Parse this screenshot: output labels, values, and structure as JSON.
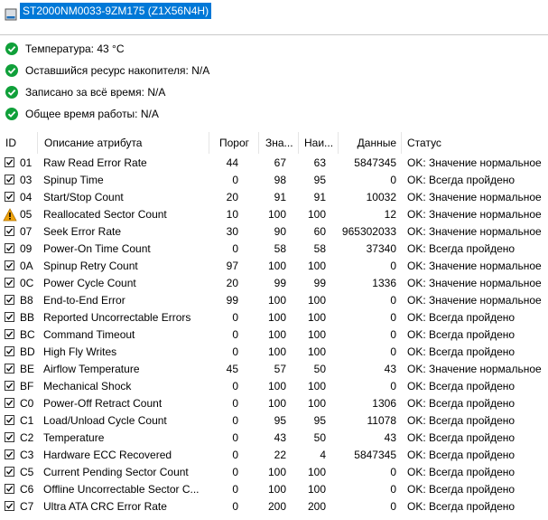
{
  "drive": {
    "title": "ST2000NM0033-9ZM175 (Z1X56N4H)"
  },
  "status": [
    {
      "label": "Температура: 43 °C"
    },
    {
      "label": "Оставшийся ресурс накопителя: N/A"
    },
    {
      "label": "Записано за всё время: N/A"
    },
    {
      "label": "Общее время работы: N/A"
    }
  ],
  "table": {
    "headers": {
      "id": "ID",
      "desc": "Описание атрибута",
      "threshold": "Порог",
      "value": "Зна...",
      "worst": "Наи...",
      "data": "Данные",
      "status": "Статус"
    },
    "rows": [
      {
        "id": "01",
        "desc": "Raw Read Error Rate",
        "threshold": "44",
        "value": "67",
        "worst": "63",
        "data": "5847345",
        "status": "OK: Значение нормальное",
        "icon": "checkbox"
      },
      {
        "id": "03",
        "desc": "Spinup Time",
        "threshold": "0",
        "value": "98",
        "worst": "95",
        "data": "0",
        "status": "OK: Всегда пройдено",
        "icon": "checkbox"
      },
      {
        "id": "04",
        "desc": "Start/Stop Count",
        "threshold": "20",
        "value": "91",
        "worst": "91",
        "data": "10032",
        "status": "OK: Значение нормальное",
        "icon": "checkbox"
      },
      {
        "id": "05",
        "desc": "Reallocated Sector Count",
        "threshold": "10",
        "value": "100",
        "worst": "100",
        "data": "12",
        "status": "OK: Значение нормальное",
        "icon": "warning"
      },
      {
        "id": "07",
        "desc": "Seek Error Rate",
        "threshold": "30",
        "value": "90",
        "worst": "60",
        "data": "965302033",
        "status": "OK: Значение нормальное",
        "icon": "checkbox"
      },
      {
        "id": "09",
        "desc": "Power-On Time Count",
        "threshold": "0",
        "value": "58",
        "worst": "58",
        "data": "37340",
        "status": "OK: Всегда пройдено",
        "icon": "checkbox"
      },
      {
        "id": "0A",
        "desc": "Spinup Retry Count",
        "threshold": "97",
        "value": "100",
        "worst": "100",
        "data": "0",
        "status": "OK: Значение нормальное",
        "icon": "checkbox"
      },
      {
        "id": "0C",
        "desc": "Power Cycle Count",
        "threshold": "20",
        "value": "99",
        "worst": "99",
        "data": "1336",
        "status": "OK: Значение нормальное",
        "icon": "checkbox"
      },
      {
        "id": "B8",
        "desc": "End-to-End Error",
        "threshold": "99",
        "value": "100",
        "worst": "100",
        "data": "0",
        "status": "OK: Значение нормальное",
        "icon": "checkbox"
      },
      {
        "id": "BB",
        "desc": "Reported Uncorrectable Errors",
        "threshold": "0",
        "value": "100",
        "worst": "100",
        "data": "0",
        "status": "OK: Всегда пройдено",
        "icon": "checkbox"
      },
      {
        "id": "BC",
        "desc": "Command Timeout",
        "threshold": "0",
        "value": "100",
        "worst": "100",
        "data": "0",
        "status": "OK: Всегда пройдено",
        "icon": "checkbox"
      },
      {
        "id": "BD",
        "desc": "High Fly Writes",
        "threshold": "0",
        "value": "100",
        "worst": "100",
        "data": "0",
        "status": "OK: Всегда пройдено",
        "icon": "checkbox"
      },
      {
        "id": "BE",
        "desc": "Airflow Temperature",
        "threshold": "45",
        "value": "57",
        "worst": "50",
        "data": "43",
        "status": "OK: Значение нормальное",
        "icon": "checkbox"
      },
      {
        "id": "BF",
        "desc": "Mechanical Shock",
        "threshold": "0",
        "value": "100",
        "worst": "100",
        "data": "0",
        "status": "OK: Всегда пройдено",
        "icon": "checkbox"
      },
      {
        "id": "C0",
        "desc": "Power-Off Retract Count",
        "threshold": "0",
        "value": "100",
        "worst": "100",
        "data": "1306",
        "status": "OK: Всегда пройдено",
        "icon": "checkbox"
      },
      {
        "id": "C1",
        "desc": "Load/Unload Cycle Count",
        "threshold": "0",
        "value": "95",
        "worst": "95",
        "data": "11078",
        "status": "OK: Всегда пройдено",
        "icon": "checkbox"
      },
      {
        "id": "C2",
        "desc": "Temperature",
        "threshold": "0",
        "value": "43",
        "worst": "50",
        "data": "43",
        "status": "OK: Всегда пройдено",
        "icon": "checkbox"
      },
      {
        "id": "C3",
        "desc": "Hardware ECC Recovered",
        "threshold": "0",
        "value": "22",
        "worst": "4",
        "data": "5847345",
        "status": "OK: Всегда пройдено",
        "icon": "checkbox"
      },
      {
        "id": "C5",
        "desc": "Current Pending Sector Count",
        "threshold": "0",
        "value": "100",
        "worst": "100",
        "data": "0",
        "status": "OK: Всегда пройдено",
        "icon": "checkbox"
      },
      {
        "id": "C6",
        "desc": "Offline Uncorrectable Sector C...",
        "threshold": "0",
        "value": "100",
        "worst": "100",
        "data": "0",
        "status": "OK: Всегда пройдено",
        "icon": "checkbox"
      },
      {
        "id": "C7",
        "desc": "Ultra ATA CRC Error Rate",
        "threshold": "0",
        "value": "200",
        "worst": "200",
        "data": "0",
        "status": "OK: Всегда пройдено",
        "icon": "checkbox"
      }
    ]
  },
  "colors": {
    "accent": "#0078d7",
    "ok": "#10a03a",
    "warning": "#f0a30a"
  }
}
